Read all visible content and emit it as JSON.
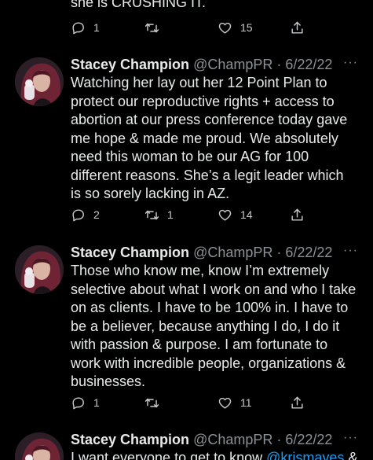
{
  "top": {
    "clipped_text": "she is CRUSHING IT.",
    "actions": {
      "reply_count": "1",
      "retweet_count": "",
      "like_count": "15"
    }
  },
  "tweets": [
    {
      "name": "Stacey Champion",
      "meta": "@ChampPR · 6/22/22",
      "more": "···",
      "lines": [
        "Watching her lay out her 12 Point Plan to",
        "protect our reproductive rights + access to",
        "abortion at our press conference today gave",
        "me hope & made me proud. We absolutely",
        "need this woman to be our AG for 100",
        "different reasons. She’s a legit leader which",
        "is so sorely lacking in AZ."
      ],
      "actions": {
        "reply_count": "2",
        "retweet_count": "1",
        "like_count": "14"
      }
    },
    {
      "name": "Stacey Champion",
      "meta": "@ChampPR · 6/22/22",
      "more": "···",
      "lines": [
        "Those who know me, know I’m extremely",
        "selective about what I work on and who I take",
        "on as clients. I have to be 100% in. I have to",
        "be a believer, because anything I do, I do it",
        "with passion & purpose. I am fortunate to",
        "work with incredible people, organizations &",
        "businesses."
      ],
      "actions": {
        "reply_count": "1",
        "retweet_count": "",
        "like_count": "11"
      }
    },
    {
      "name": "Stacey Champion",
      "meta": "@ChampPR · 6/22/22",
      "more": "···",
      "line_start": "I want everyone to get to know ",
      "mention": "@krismayes",
      "line_end": " &"
    }
  ],
  "icons": {
    "reply": "reply-icon",
    "retweet": "retweet-icon",
    "like": "heart-icon",
    "share": "share-icon",
    "more": "more-icon"
  }
}
